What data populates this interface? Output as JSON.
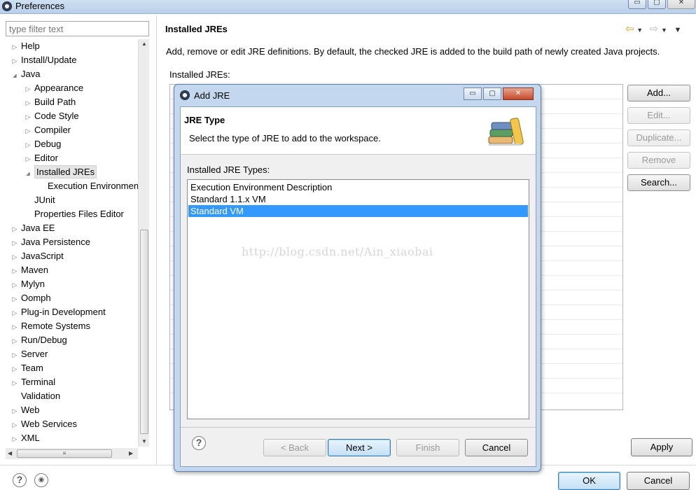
{
  "window": {
    "title": "Preferences",
    "caption_buttons": [
      "▭",
      "▢",
      "✕"
    ]
  },
  "filter": {
    "placeholder": "type filter text"
  },
  "tree": {
    "items": [
      {
        "label": "Help",
        "level": 0,
        "expander": "collapsed"
      },
      {
        "label": "Install/Update",
        "level": 0,
        "expander": "collapsed"
      },
      {
        "label": "Java",
        "level": 0,
        "expander": "expanded"
      },
      {
        "label": "Appearance",
        "level": 1,
        "expander": "collapsed"
      },
      {
        "label": "Build Path",
        "level": 1,
        "expander": "collapsed"
      },
      {
        "label": "Code Style",
        "level": 1,
        "expander": "collapsed"
      },
      {
        "label": "Compiler",
        "level": 1,
        "expander": "collapsed"
      },
      {
        "label": "Debug",
        "level": 1,
        "expander": "collapsed"
      },
      {
        "label": "Editor",
        "level": 1,
        "expander": "collapsed"
      },
      {
        "label": "Installed JREs",
        "level": 1,
        "expander": "expanded",
        "selected": true
      },
      {
        "label": "Execution Environmen",
        "level": 2,
        "expander": "none"
      },
      {
        "label": "JUnit",
        "level": 1,
        "expander": "none"
      },
      {
        "label": "Properties Files Editor",
        "level": 1,
        "expander": "none"
      },
      {
        "label": "Java EE",
        "level": 0,
        "expander": "collapsed"
      },
      {
        "label": "Java Persistence",
        "level": 0,
        "expander": "collapsed"
      },
      {
        "label": "JavaScript",
        "level": 0,
        "expander": "collapsed"
      },
      {
        "label": "Maven",
        "level": 0,
        "expander": "collapsed"
      },
      {
        "label": "Mylyn",
        "level": 0,
        "expander": "collapsed"
      },
      {
        "label": "Oomph",
        "level": 0,
        "expander": "collapsed"
      },
      {
        "label": "Plug-in Development",
        "level": 0,
        "expander": "collapsed"
      },
      {
        "label": "Remote Systems",
        "level": 0,
        "expander": "collapsed"
      },
      {
        "label": "Run/Debug",
        "level": 0,
        "expander": "collapsed"
      },
      {
        "label": "Server",
        "level": 0,
        "expander": "collapsed"
      },
      {
        "label": "Team",
        "level": 0,
        "expander": "collapsed"
      },
      {
        "label": "Terminal",
        "level": 0,
        "expander": "collapsed"
      },
      {
        "label": "Validation",
        "level": 0,
        "expander": "none"
      },
      {
        "label": "Web",
        "level": 0,
        "expander": "collapsed"
      },
      {
        "label": "Web Services",
        "level": 0,
        "expander": "collapsed"
      },
      {
        "label": "XML",
        "level": 0,
        "expander": "collapsed"
      }
    ]
  },
  "page": {
    "title": "Installed JREs",
    "description": "Add, remove or edit JRE definitions. By default, the checked JRE is added to the build path of newly created Java projects.",
    "table_label": "Installed JREs:",
    "buttons": [
      {
        "label": "Add...",
        "enabled": true
      },
      {
        "label": "Edit...",
        "enabled": false
      },
      {
        "label": "Duplicate...",
        "enabled": false
      },
      {
        "label": "Remove",
        "enabled": false
      },
      {
        "label": "Search...",
        "enabled": true
      }
    ],
    "apply_label": "Apply"
  },
  "footer": {
    "ok_label": "OK",
    "cancel_label": "Cancel"
  },
  "dialog": {
    "title": "Add JRE",
    "header_title": "JRE Type",
    "header_desc": "Select the type of JRE to add to the workspace.",
    "list_label": "Installed JRE Types:",
    "types": [
      {
        "label": "Execution Environment Description",
        "selected": false
      },
      {
        "label": "Standard 1.1.x VM",
        "selected": false
      },
      {
        "label": "Standard VM",
        "selected": true
      }
    ],
    "buttons": {
      "back": "< Back",
      "next": "Next >",
      "finish": "Finish",
      "cancel": "Cancel"
    },
    "caption_buttons": [
      "▭",
      "▢",
      "✕"
    ]
  },
  "watermark": "http://blog.csdn.net/Ain_xiaobai",
  "colors": {
    "selection": "#3399ff",
    "dialog_frame": "#c3d8ee",
    "nav_arrow": "#d8a128"
  }
}
